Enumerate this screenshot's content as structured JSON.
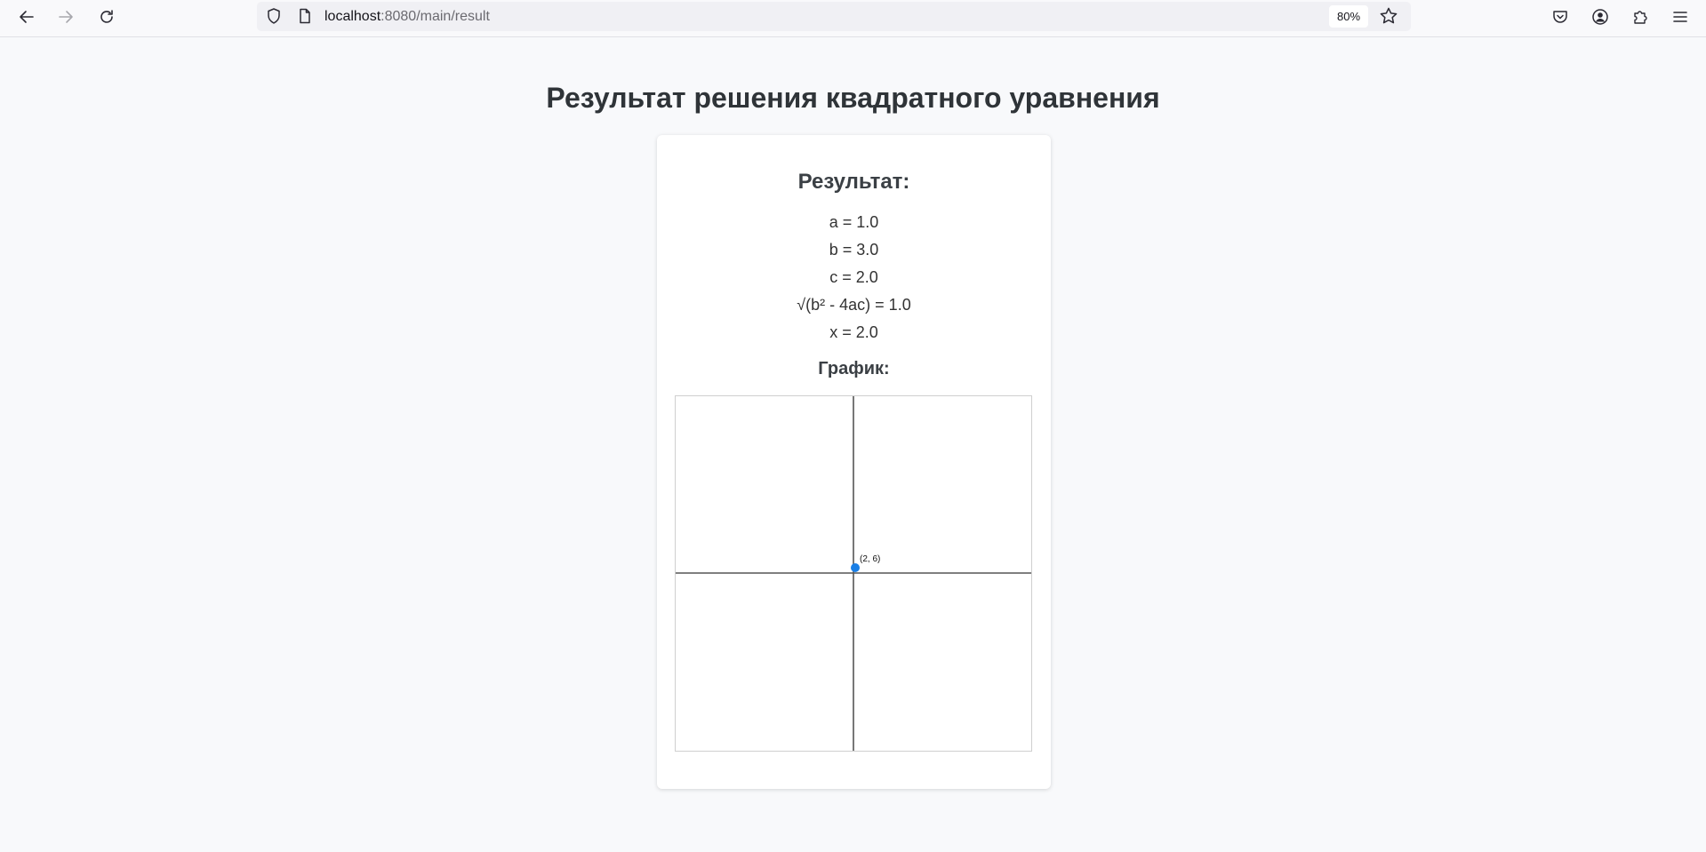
{
  "browser": {
    "url_host": "localhost",
    "url_rest": ":8080/main/result",
    "zoom": "80%"
  },
  "page": {
    "title": "Результат решения квадратного уравнения"
  },
  "result": {
    "heading": "Результат:",
    "a": "a = 1.0",
    "b": "b = 3.0",
    "c": "c = 2.0",
    "disc": "√(b² - 4ac) = 1.0",
    "x": "x = 2.0"
  },
  "graph": {
    "heading": "График:"
  },
  "chart_data": {
    "type": "scatter",
    "points": [
      {
        "x": 2,
        "y": 6,
        "label": "(2, 6)"
      }
    ],
    "point_color": "#1a7fe6",
    "axis_color": "#555555"
  }
}
